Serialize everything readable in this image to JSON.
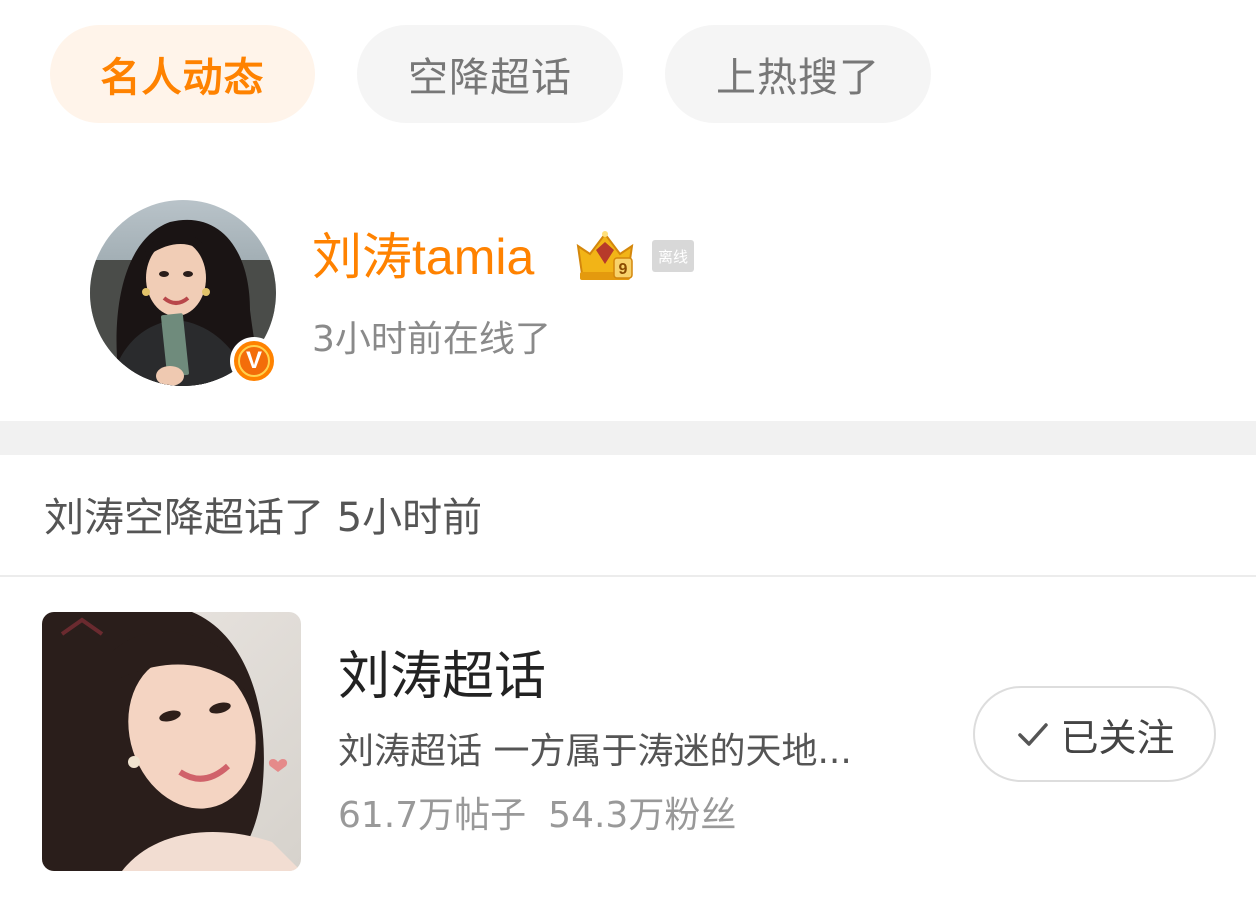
{
  "tabs": [
    {
      "label": "名人动态",
      "active": true
    },
    {
      "label": "空降超话",
      "active": false
    },
    {
      "label": "上热搜了",
      "active": false
    }
  ],
  "profile": {
    "name": "刘涛tamia",
    "status_tag": "离线",
    "online_time": "3小时前在线了",
    "verify_badge": "V",
    "crown_level": "9"
  },
  "activity": {
    "text": "刘涛空降超话了 5小时前"
  },
  "topic": {
    "title": "刘涛超话",
    "description": "刘涛超话 一方属于涛迷的天地...",
    "posts": "61.7万帖子",
    "fans": "54.3万粉丝",
    "follow_label": "已关注"
  },
  "colors": {
    "accent": "#ff8200",
    "tab_active_bg": "#fff4ea",
    "tab_bg": "#f5f5f5"
  },
  "icons": {
    "crown": "crown-level-icon",
    "verify": "verified-v-icon",
    "check": "check-icon"
  }
}
